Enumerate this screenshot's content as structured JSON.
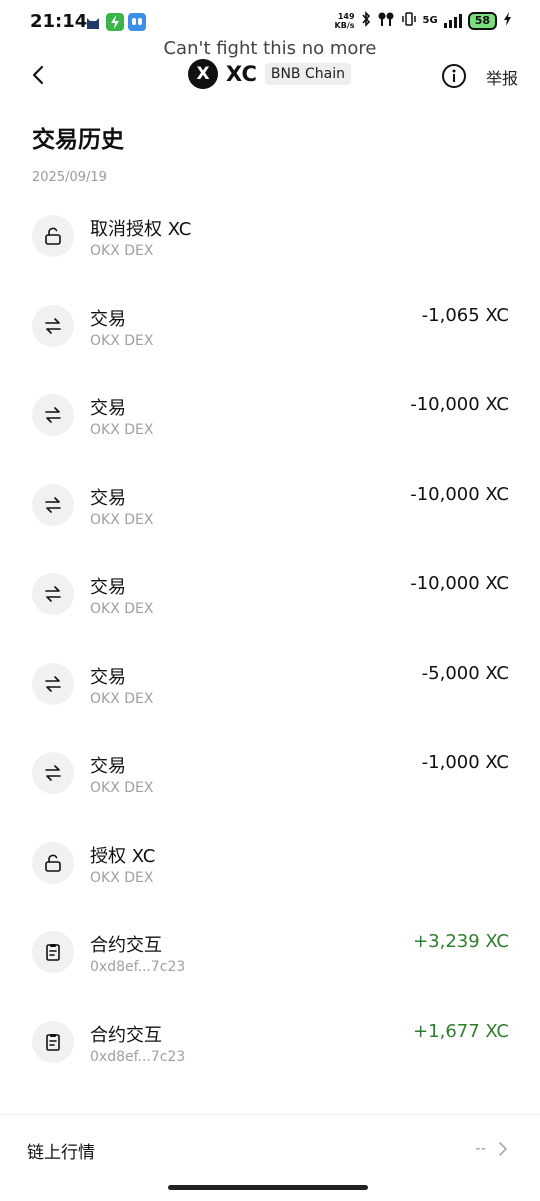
{
  "status_bar": {
    "time": "21:14",
    "net_speed_value": "149",
    "net_speed_unit": "KB/s",
    "network": "5G",
    "battery": "58",
    "icons": [
      "cat-app-icon",
      "green-bolt-app-icon",
      "blue-cloud-app-icon",
      "bluetooth-icon",
      "earbuds-icon",
      "vibrate-icon",
      "signal-icon",
      "charging-icon"
    ]
  },
  "overlay_text": "Can't fight this no more",
  "header": {
    "token_logo_letter": "X",
    "token_symbol": "XC",
    "chain": "BNB Chain",
    "report_label": "举报",
    "back_icon": "chevron-left-icon",
    "info_icon": "info-circle-icon"
  },
  "page_title": "交易历史",
  "date": "2025/09/19",
  "transactions": [
    {
      "icon": "unlock-icon",
      "title": "取消授权 XC",
      "sub": "OKX DEX",
      "amount": ""
    },
    {
      "icon": "swap-icon",
      "title": "交易",
      "sub": "OKX DEX",
      "amount": "-1,065 XC"
    },
    {
      "icon": "swap-icon",
      "title": "交易",
      "sub": "OKX DEX",
      "amount": "-10,000 XC"
    },
    {
      "icon": "swap-icon",
      "title": "交易",
      "sub": "OKX DEX",
      "amount": "-10,000 XC"
    },
    {
      "icon": "swap-icon",
      "title": "交易",
      "sub": "OKX DEX",
      "amount": "-10,000 XC"
    },
    {
      "icon": "swap-icon",
      "title": "交易",
      "sub": "OKX DEX",
      "amount": "-5,000 XC"
    },
    {
      "icon": "swap-icon",
      "title": "交易",
      "sub": "OKX DEX",
      "amount": "-1,000 XC"
    },
    {
      "icon": "unlock-icon",
      "title": "授权 XC",
      "sub": "OKX DEX",
      "amount": ""
    },
    {
      "icon": "contract-icon",
      "title": "合约交互",
      "sub": "0xd8ef...7c23",
      "amount": "+3,239 XC"
    },
    {
      "icon": "contract-icon",
      "title": "合约交互",
      "sub": "0xd8ef...7c23",
      "amount": "+1,677 XC"
    }
  ],
  "bottom": {
    "label": "链上行情",
    "value": "--",
    "chevron_icon": "chevron-right-icon"
  },
  "colors": {
    "positive_amount": "#2f7d2f",
    "negative_amount": "#111111",
    "icon_bg": "#f1f1f1",
    "muted_text": "#a0a0a0"
  }
}
